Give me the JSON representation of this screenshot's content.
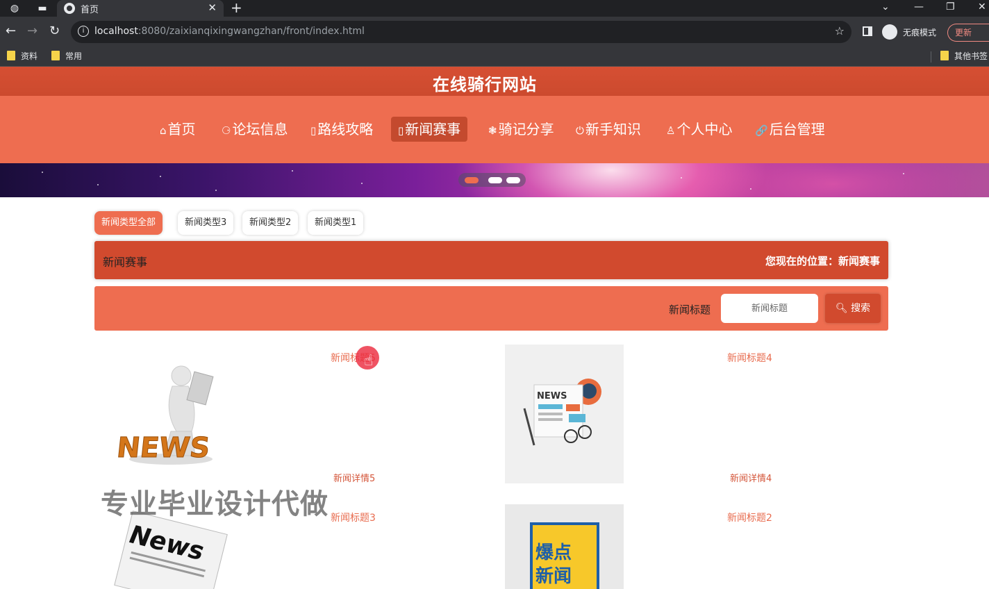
{
  "browser": {
    "tab_title": "首页",
    "url_host": "localhost",
    "url_rest": ":8080/zaixianqixingwangzhan/front/index.html",
    "incognito_label": "无痕模式",
    "update_label": "更新",
    "bookmarks": [
      "资料",
      "常用"
    ],
    "other_bookmarks": "其他书签"
  },
  "site": {
    "title": "在线骑行网站",
    "nav": [
      {
        "icon": "⌂",
        "label": "首页"
      },
      {
        "icon": "⚆",
        "label": "论坛信息"
      },
      {
        "icon": "▯",
        "label": "路线攻略"
      },
      {
        "icon": "▯",
        "label": "新闻赛事"
      },
      {
        "icon": "❃",
        "label": "骑记分享"
      },
      {
        "icon": "⏻",
        "label": "新手知识"
      },
      {
        "icon": "♙",
        "label": "个人中心"
      },
      {
        "icon": "🔗",
        "label": "后台管理"
      }
    ],
    "active_nav": "新闻赛事",
    "banner_dots": 3
  },
  "filters": [
    "新闻类型全部",
    "新闻类型3",
    "新闻类型2",
    "新闻类型1"
  ],
  "section": {
    "title": "新闻赛事",
    "breadcrumb": "您现在的位置：新闻赛事"
  },
  "search": {
    "label": "新闻标题",
    "placeholder": "新闻标题",
    "button": "搜索"
  },
  "news": [
    {
      "title": "新闻标题5",
      "detail": "新闻详情5",
      "image": "news-3d-man"
    },
    {
      "title": "新闻标题4",
      "detail": "新闻详情4",
      "image": "news-flat"
    },
    {
      "title": "新闻标题3",
      "detail": "",
      "image": "news-paper"
    },
    {
      "title": "新闻标题2",
      "detail": "",
      "image": "news-burst"
    }
  ],
  "watermark": "专业毕业设计代做",
  "colors": {
    "header": "#d14a2e",
    "nav": "#ee6d50",
    "accent_text": "#e86c4f"
  }
}
